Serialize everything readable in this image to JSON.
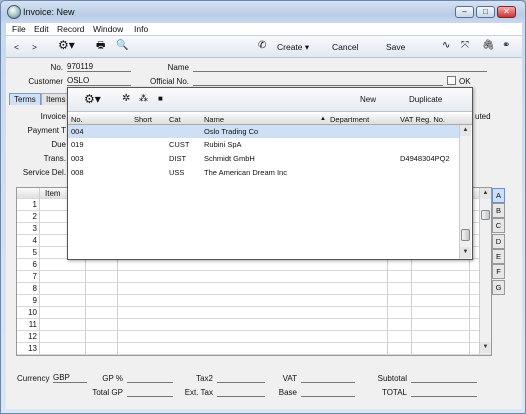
{
  "window": {
    "title": "Invoice: New"
  },
  "menubar": [
    "File",
    "Edit",
    "Record",
    "Window",
    "Info"
  ],
  "toolbar": {
    "prev": "<",
    "next": ">",
    "create_label": "Create",
    "cancel_label": "Cancel",
    "save_label": "Save"
  },
  "header": {
    "no_label": "No.",
    "no_value": "970119",
    "name_label": "Name",
    "name_value": "",
    "customer_label": "Customer",
    "customer_value": "OSLO",
    "official_label": "Official No.",
    "ok_label": "OK"
  },
  "tabs": [
    "Terms",
    "Items"
  ],
  "terms_labels": {
    "invoice": "Invoice",
    "payment": "Payment T",
    "due": "Due",
    "trans": "Trans.",
    "service": "Service Del.",
    "right": "uted"
  },
  "matrix": {
    "item_header": "Item",
    "rows": [
      "1",
      "2",
      "3",
      "4",
      "5",
      "6",
      "7",
      "8",
      "9",
      "10",
      "11",
      "12",
      "13"
    ]
  },
  "side_tabs": [
    "A",
    "B",
    "C",
    "D",
    "E",
    "F",
    "G"
  ],
  "popup": {
    "new_label": "New",
    "duplicate_label": "Duplicate",
    "columns": {
      "no": "No.",
      "short": "Short",
      "cat": "Cat",
      "name": "Name",
      "department": "Department",
      "vat": "VAT Reg. No."
    },
    "rows": [
      {
        "no": "004",
        "short": "",
        "cat": "",
        "name": "Oslo Trading Co",
        "department": "",
        "vat": ""
      },
      {
        "no": "019",
        "short": "",
        "cat": "CUST",
        "name": "Rubini SpA",
        "department": "",
        "vat": ""
      },
      {
        "no": "003",
        "short": "",
        "cat": "DIST",
        "name": "Schmidt GmbH",
        "department": "",
        "vat": "D4948304PQ2"
      },
      {
        "no": "008",
        "short": "",
        "cat": "USS",
        "name": "The American Dream Inc",
        "department": "",
        "vat": ""
      }
    ]
  },
  "footer": {
    "currency_label": "Currency",
    "currency_value": "GBP",
    "gp_pct_label": "GP %",
    "total_gp_label": "Total GP",
    "tax2_label": "Tax2",
    "ext_tax_label": "Ext. Tax",
    "vat_label": "VAT",
    "base_label": "Base",
    "subtotal_label": "Subtotal",
    "total_label": "TOTAL"
  }
}
